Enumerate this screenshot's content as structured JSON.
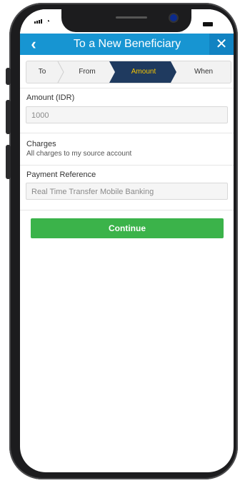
{
  "header": {
    "title": "To a New Beneficiary",
    "back_icon": "‹",
    "close_icon": "✕"
  },
  "steps": [
    {
      "label": "To",
      "active": false
    },
    {
      "label": "From",
      "active": false
    },
    {
      "label": "Amount",
      "active": true
    },
    {
      "label": "When",
      "active": false
    }
  ],
  "amount": {
    "label": "Amount (IDR)",
    "value": "1000"
  },
  "charges": {
    "title": "Charges",
    "value": "All charges to my source account"
  },
  "reference": {
    "label": "Payment Reference",
    "value": "Real Time Transfer Mobile Banking"
  },
  "continue_label": "Continue",
  "colors": {
    "header": "#1795d2",
    "step_active": "#1f3a5f",
    "step_active_text": "#f5c400",
    "continue": "#3bb34a"
  }
}
